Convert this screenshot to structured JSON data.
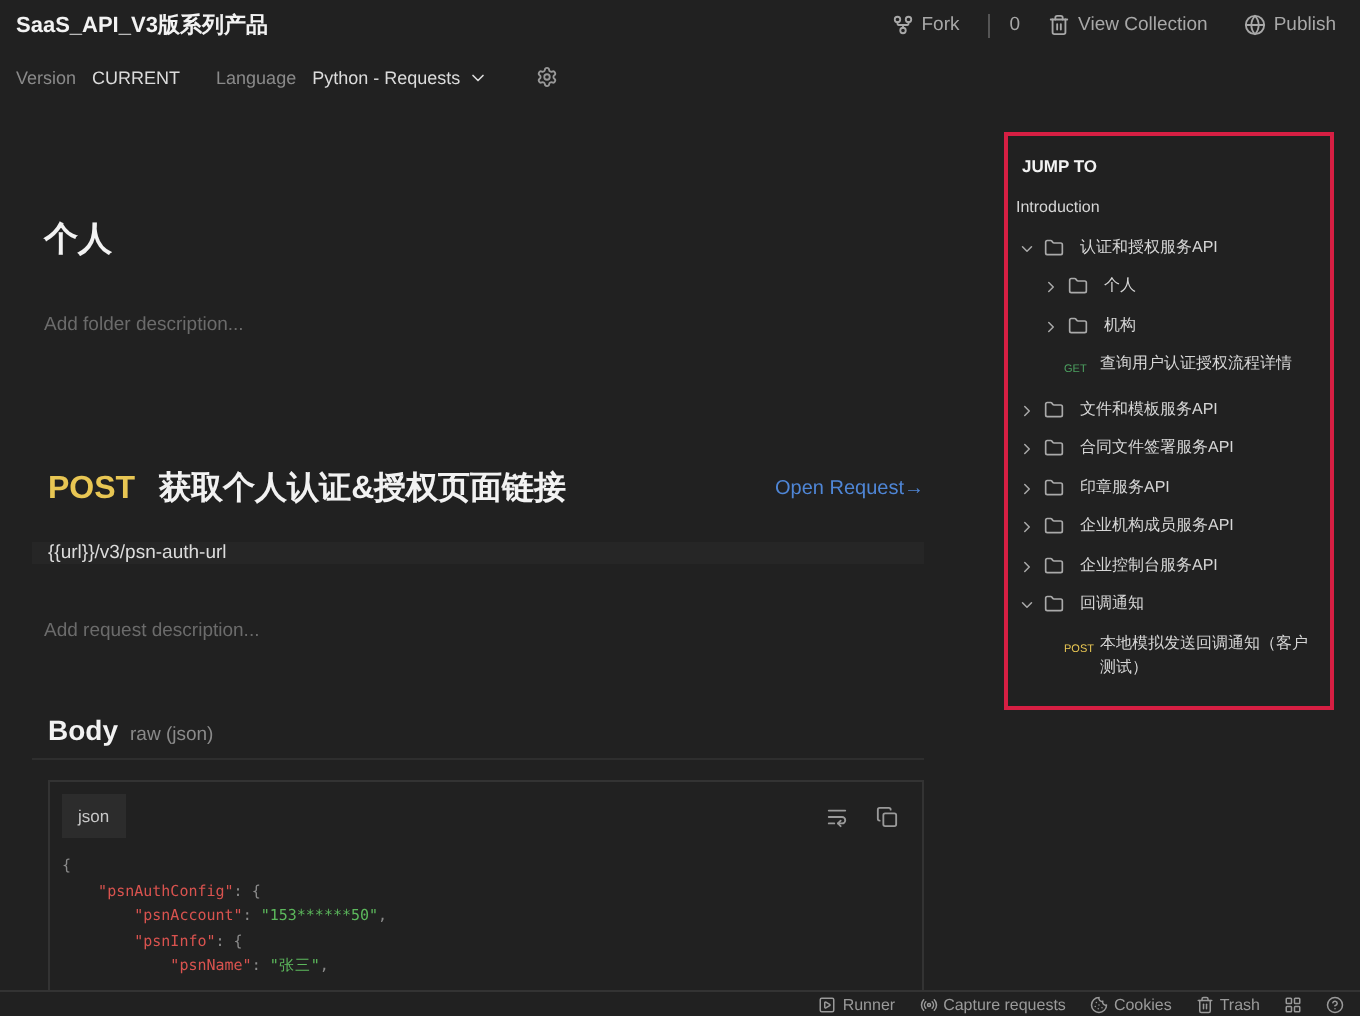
{
  "header": {
    "title": "SaaS_API_V3版系列产品",
    "fork_label": "Fork",
    "fork_count": "0",
    "view_collection": "View Collection",
    "publish": "Publish"
  },
  "settings": {
    "version_label": "Version",
    "version": "CURRENT",
    "language_label": "Language",
    "language": "Python - Requests"
  },
  "folder": {
    "title": "个人",
    "description_placeholder": "Add folder description..."
  },
  "request": {
    "method": "POST",
    "name": "获取个人认证&授权页面链接",
    "open_link": "Open Request→",
    "url": "{{url}}/v3/psn-auth-url",
    "description_placeholder": "Add request description..."
  },
  "body": {
    "title": "Body",
    "mode": "raw (json)",
    "language_tab": "json",
    "code_lines": [
      [
        {
          "kind": "punct",
          "text": "{"
        }
      ],
      [
        {
          "kind": "key",
          "text": "    \"psnAuthConfig\""
        },
        {
          "kind": "punct",
          "text": ": {"
        }
      ],
      [
        {
          "kind": "key",
          "text": "        \"psnAccount\""
        },
        {
          "kind": "punct",
          "text": ": "
        },
        {
          "kind": "string",
          "text": "\"153******50\""
        },
        {
          "kind": "punct",
          "text": ","
        }
      ],
      [
        {
          "kind": "key",
          "text": "        \"psnInfo\""
        },
        {
          "kind": "punct",
          "text": ": {"
        }
      ],
      [
        {
          "kind": "key",
          "text": "            \"psnName\""
        },
        {
          "kind": "punct",
          "text": ": "
        },
        {
          "kind": "string",
          "text": "\"张三\""
        },
        {
          "kind": "punct",
          "text": ","
        }
      ]
    ]
  },
  "jump_to": {
    "title": "JUMP TO",
    "items": [
      {
        "kind": "link",
        "label": "Introduction"
      },
      {
        "kind": "folder",
        "label": "认证和授权服务API",
        "expanded": true,
        "children": [
          {
            "kind": "folder",
            "label": "个人",
            "expanded": false
          },
          {
            "kind": "folder",
            "label": "机构",
            "expanded": false
          },
          {
            "kind": "request",
            "method": "GET",
            "label": "查询用户认证授权流程详情"
          }
        ]
      },
      {
        "kind": "folder",
        "label": "文件和模板服务API",
        "expanded": false
      },
      {
        "kind": "folder",
        "label": "合同文件签署服务API",
        "expanded": false
      },
      {
        "kind": "folder",
        "label": "印章服务API",
        "expanded": false
      },
      {
        "kind": "folder",
        "label": "企业机构成员服务API",
        "expanded": false
      },
      {
        "kind": "folder",
        "label": "企业控制台服务API",
        "expanded": false
      },
      {
        "kind": "folder",
        "label": "回调通知",
        "expanded": true,
        "children": [
          {
            "kind": "request",
            "method": "POST",
            "label": "本地模拟发送回调通知（客户测试）"
          }
        ]
      }
    ]
  },
  "status_bar": {
    "items": [
      "Runner",
      "Capture requests",
      "Cookies",
      "Trash"
    ]
  }
}
